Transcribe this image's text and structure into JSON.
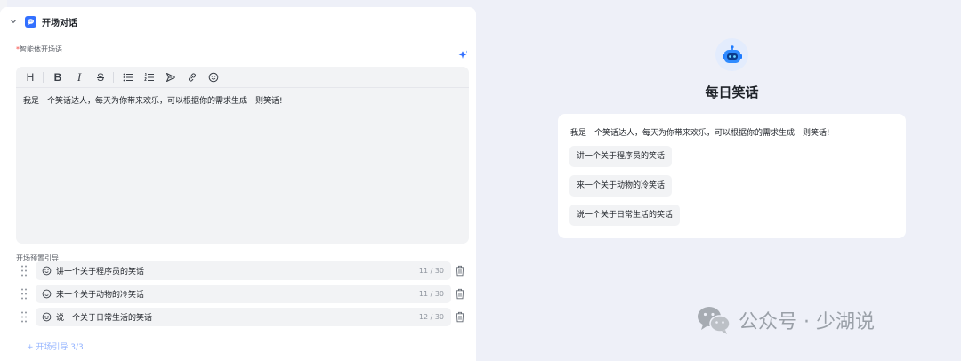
{
  "section": {
    "title": "开场对话"
  },
  "opening": {
    "required_mark": "*",
    "label": "智能体开场语",
    "text": "我是一个笑话达人，每天为你带来欢乐，可以根据你的需求生成一则笑话!"
  },
  "toolbar": {
    "heading": "H",
    "bold": "B",
    "italic": "I",
    "strike": "S"
  },
  "guides": {
    "label": "开场预置引导",
    "items": [
      {
        "text": "讲一个关于程序员的笑话",
        "count": "11 / 30"
      },
      {
        "text": "来一个关于动物的冷笑话",
        "count": "11 / 30"
      },
      {
        "text": "说一个关于日常生活的笑话",
        "count": "12 / 30"
      }
    ],
    "add_label": "+ 开场引导 3/3"
  },
  "preview": {
    "bot_name": "每日笑话",
    "greeting": "我是一个笑话达人，每天为你带来欢乐，可以根据你的需求生成一则笑话!",
    "suggestions": [
      "讲一个关于程序员的笑话",
      "来一个关于动物的冷笑话",
      "说一个关于日常生活的笑话"
    ]
  },
  "watermark": {
    "text": "公众号 · 少湖说"
  },
  "colors": {
    "accent": "#3370ff",
    "panel_bg": "#ffffff",
    "page_bg": "#eef0f8",
    "field_bg": "#f2f3f5"
  }
}
